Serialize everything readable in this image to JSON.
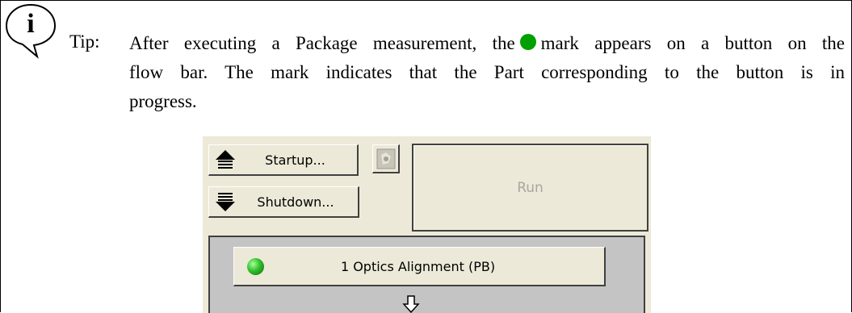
{
  "tip": {
    "label": "Tip:",
    "line1_a": "After executing a Package measurement, the",
    "line1_b": "mark appears on a button on the",
    "line2": "flow bar. The mark indicates that the Part corresponding to the button is in",
    "line3": "progress.",
    "dot_color": "#00a000"
  },
  "icons": {
    "info": "info-speech-bubble-icon",
    "startup": "startup-arrow-up-icon",
    "shutdown": "shutdown-arrow-down-icon",
    "mini": "status-image-icon",
    "part_status": "green-ball-icon",
    "flow_arrow": "down-arrow-icon"
  },
  "panel": {
    "startup_label": "Startup...",
    "shutdown_label": "Shutdown...",
    "run_label": "Run",
    "part_label": "1 Optics Alignment (PB)"
  }
}
